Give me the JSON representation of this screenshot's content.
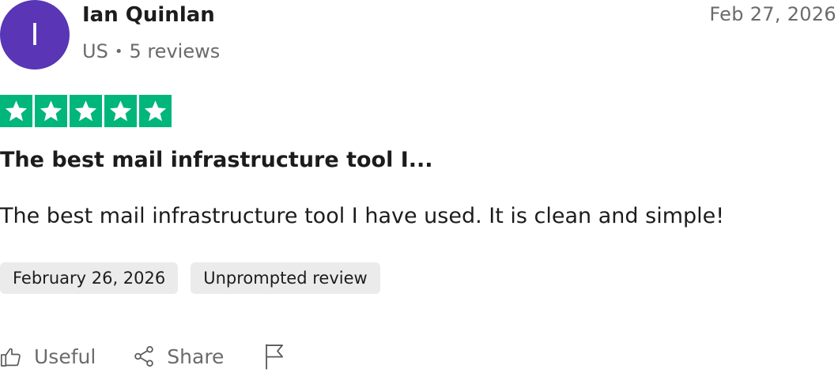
{
  "reviewer": {
    "initial": "I",
    "name": "Ian Quinlan",
    "country": "US",
    "separator": "•",
    "reviews": "5 reviews",
    "avatar_color": "#5a35b5"
  },
  "review": {
    "date": "Feb 27, 2026",
    "rating": 5,
    "max_rating": 5,
    "star_color": "#00b67a",
    "title": "The best mail infrastructure tool I...",
    "body": "The best mail infrastructure tool I have used. It is clean and simple!",
    "tags": {
      "experience_date": "February 26, 2026",
      "type": "Unprompted review"
    }
  },
  "actions": {
    "useful_label": "Useful",
    "share_label": "Share",
    "useful_icon": "thumbs-up-icon",
    "share_icon": "share-icon",
    "report_icon": "flag-icon"
  }
}
